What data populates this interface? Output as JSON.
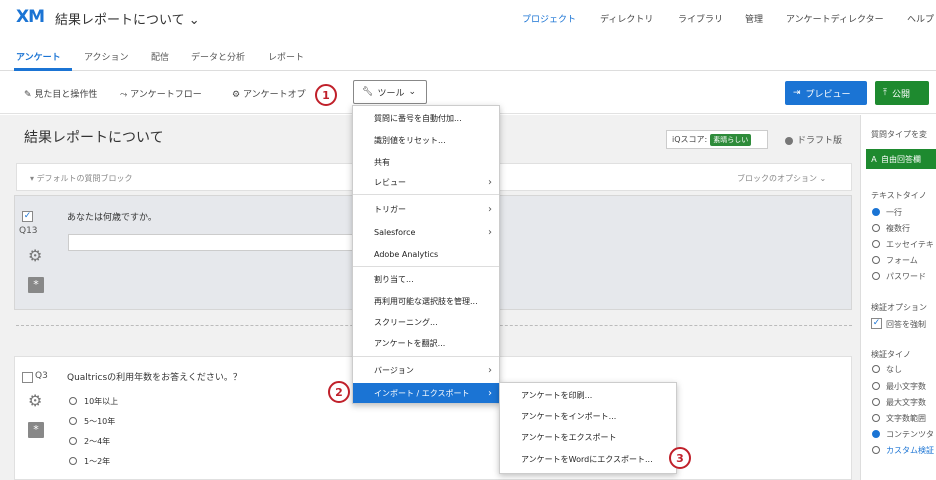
{
  "app": {
    "logo": "XM",
    "project_title": "結果レポートについて ⌄"
  },
  "topnav": [
    "プロジェクト",
    "ディレクトリ",
    "ライブラリ",
    "管理",
    "アンケートディレクター",
    "ヘルプ"
  ],
  "subnav": [
    "アンケート",
    "アクション",
    "配信",
    "データと分析",
    "レポート"
  ],
  "toolbar": {
    "look_feel": "見た目と操作性",
    "survey_flow": "アンケートフロー",
    "survey_options": "アンケートオプ",
    "tools": "ツール",
    "preview": "プレビュー",
    "publish": "公開"
  },
  "survey": {
    "title": "結果レポートについて",
    "iq_score_label": "iQスコア:",
    "iq_score_value": "素晴らしい",
    "draft": "ドラフト版",
    "block_label": "デフォルトの質問ブロック",
    "block_options": "ブロックのオプション ⌄"
  },
  "q13": {
    "number": "Q13",
    "text": "あなたは何歳ですか。"
  },
  "q3": {
    "number": "Q3",
    "text": "Qualtricsの利用年数をお答えください。？",
    "options": [
      "10年以上",
      "5～10年",
      "2～4年",
      "1～2年"
    ]
  },
  "tools_menu": {
    "items": [
      {
        "label": "質問に番号を自動付加...",
        "arrow": false
      },
      {
        "label": "識別値をリセット...",
        "arrow": false
      },
      {
        "label": "共有",
        "arrow": false
      },
      {
        "label": "レビュー",
        "arrow": true
      },
      {
        "label": "トリガー",
        "arrow": true
      },
      {
        "label": "Salesforce",
        "arrow": true
      },
      {
        "label": "Adobe Analytics",
        "arrow": false
      },
      {
        "label": "割り当て...",
        "arrow": false
      },
      {
        "label": "再利用可能な選択肢を管理...",
        "arrow": false
      },
      {
        "label": "スクリーニング...",
        "arrow": false
      },
      {
        "label": "アンケートを翻訳...",
        "arrow": false
      },
      {
        "label": "バージョン",
        "arrow": true
      },
      {
        "label": "インポート / エクスポート",
        "arrow": true
      }
    ],
    "arrow_glyph": "›"
  },
  "submenu": {
    "items": [
      "アンケートを印刷...",
      "アンケートをインポート...",
      "アンケートをエクスポート",
      "アンケートをWordにエクスポート..."
    ]
  },
  "right_panel": {
    "question_type_label": "質問タイプを変",
    "question_type_value": "自由回答欄",
    "text_type_label": "テキストタイノ",
    "text_types": [
      "一行",
      "複数行",
      "エッセイテキ",
      "フォーム",
      "パスワード"
    ],
    "validation_label": "検証オプション",
    "force_response": "回答を強制",
    "validation_type_label": "検証タイノ",
    "validation_types": [
      "なし",
      "最小文字数",
      "最大文字数",
      "文字数範囲",
      "コンテンツタ"
    ],
    "custom_validation": "カスタム検証"
  },
  "callouts": [
    "1",
    "2",
    "3"
  ],
  "colors": {
    "accent": "#1b74d4",
    "publish": "#1e8a2f",
    "callout": "#c0202a"
  }
}
